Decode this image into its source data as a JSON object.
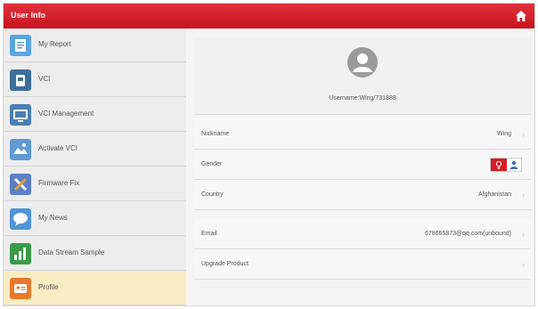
{
  "header": {
    "title": "User Info",
    "home_icon": "home-icon",
    "bar_color": "#d0212b"
  },
  "sidebar": {
    "items": [
      {
        "label": "My Report",
        "icon": "report-icon",
        "icon_color": "#5aa6df",
        "active": false
      },
      {
        "label": "VCI",
        "icon": "vci-device-icon",
        "icon_color": "#3c6e9c",
        "active": false
      },
      {
        "label": "VCI Management",
        "icon": "vci-management-icon",
        "icon_color": "#4a7fb3",
        "active": false
      },
      {
        "label": "Activate VCI",
        "icon": "activate-vci-icon",
        "icon_color": "#5f9ad3",
        "active": false
      },
      {
        "label": "Firmware Fix",
        "icon": "firmware-fix-icon",
        "icon_color": "#5a7fc8",
        "active": false
      },
      {
        "label": "My News",
        "icon": "news-icon",
        "icon_color": "#4f94d8",
        "active": false
      },
      {
        "label": "Data Stream Sample",
        "icon": "data-stream-icon",
        "icon_color": "#3a9a4a",
        "active": false
      },
      {
        "label": "Profile",
        "icon": "profile-icon",
        "icon_color": "#e8792a",
        "active": true
      }
    ],
    "active_color": "#f8ecc2"
  },
  "profile": {
    "avatar_icon": "avatar-placeholder-icon",
    "username": "Username:Wing/731888"
  },
  "fields": [
    {
      "key": "Nickname",
      "value": "Wing",
      "has_chevron": true
    },
    {
      "key": "Gender",
      "value": "",
      "female_icon": "female-icon",
      "male_icon": "male-icon",
      "selected": "female"
    },
    {
      "key": "Country",
      "value": "Afghanistan",
      "has_chevron": true
    },
    {
      "key": "Email",
      "value": "678665873@qq.com(unbound)",
      "has_chevron": true
    },
    {
      "key": "Upgrade Product",
      "value": "",
      "has_chevron": true
    }
  ]
}
